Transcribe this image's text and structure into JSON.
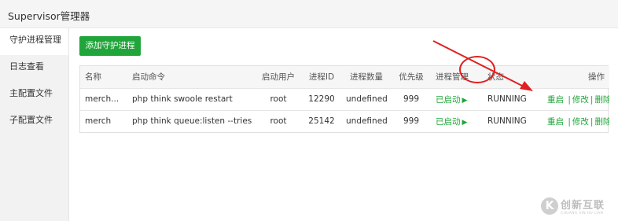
{
  "app": {
    "title": "Supervisor管理器"
  },
  "sidebar": {
    "items": [
      {
        "label": "守护进程管理"
      },
      {
        "label": "日志查看"
      },
      {
        "label": "主配置文件"
      },
      {
        "label": "子配置文件"
      }
    ]
  },
  "toolbar": {
    "add_label": "添加守护进程"
  },
  "table": {
    "headers": [
      "名称",
      "启动命令",
      "启动用户",
      "进程ID",
      "进程数量",
      "优先级",
      "进程管理",
      "状态",
      "操作"
    ],
    "rows": [
      {
        "name": "merch...",
        "command": "php think swoole restart",
        "user": "root",
        "pid": "12290",
        "count": "undefined",
        "priority": "999",
        "manage": "已启动",
        "status": "RUNNING",
        "actions": {
          "restart": "重启",
          "edit": "修改",
          "delete": "删除",
          "sep": "|"
        }
      },
      {
        "name": "merch",
        "command": "php think queue:listen --tries",
        "user": "root",
        "pid": "25142",
        "count": "undefined",
        "priority": "999",
        "manage": "已启动",
        "status": "RUNNING",
        "actions": {
          "restart": "重启",
          "edit": "修改",
          "delete": "删除",
          "sep": "|"
        }
      }
    ]
  },
  "watermark": {
    "logo": "K",
    "cn": "创新互联",
    "en": "CHUANG XIN HU LIAN"
  },
  "colors": {
    "accent": "#20a53a",
    "annotation": "#e02020"
  }
}
